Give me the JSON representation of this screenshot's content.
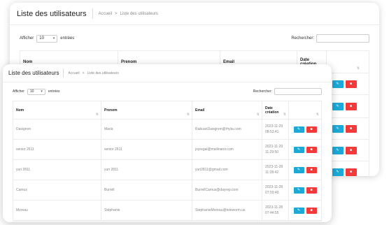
{
  "page": {
    "title": "Liste des utilisateurs",
    "breadcrumb": {
      "home": "Accueil",
      "separator": ">",
      "current": "Liste des utilisateurs"
    }
  },
  "controls": {
    "show_label": "Afficher",
    "entries_value": "10",
    "entries_label": "entrées",
    "search_label": "Rechercher:",
    "search_value": ""
  },
  "table": {
    "columns": [
      "Nom",
      "Prenom",
      "Email",
      "Date",
      "création"
    ],
    "rows": [
      {
        "nom": "Dasignon",
        "prenom": "Maria",
        "email": "RabuanDasignon@rhyta.com",
        "date": "2023-11-29",
        "time": "08:53:41"
      },
      {
        "nom": "senior 2611",
        "prenom": "senior 2611",
        "email": "joyregal@mailinator.com",
        "date": "2023-11-29",
        "time": "11:29:50"
      },
      {
        "nom": "yuri 2811",
        "prenom": "yuri 2811",
        "email": "yuri2811@gmail.com",
        "date": "2023-11-28",
        "time": "11:28:42"
      },
      {
        "nom": "Camus",
        "prenom": "Burrell",
        "email": "BurrellCamus@dayrep.com",
        "date": "2023-11-28",
        "time": "07:59:49"
      },
      {
        "nom": "Moreau",
        "prenom": "Stéphanie",
        "email": "StephanieMoreau@teleworm.us",
        "date": "2023-11-28",
        "time": "07:44:55"
      }
    ]
  },
  "actions": {
    "edit_icon": "pencil-icon",
    "delete_icon": "trash-icon"
  },
  "colors": {
    "edit": "#1da9d6",
    "delete": "#f23a3a"
  }
}
